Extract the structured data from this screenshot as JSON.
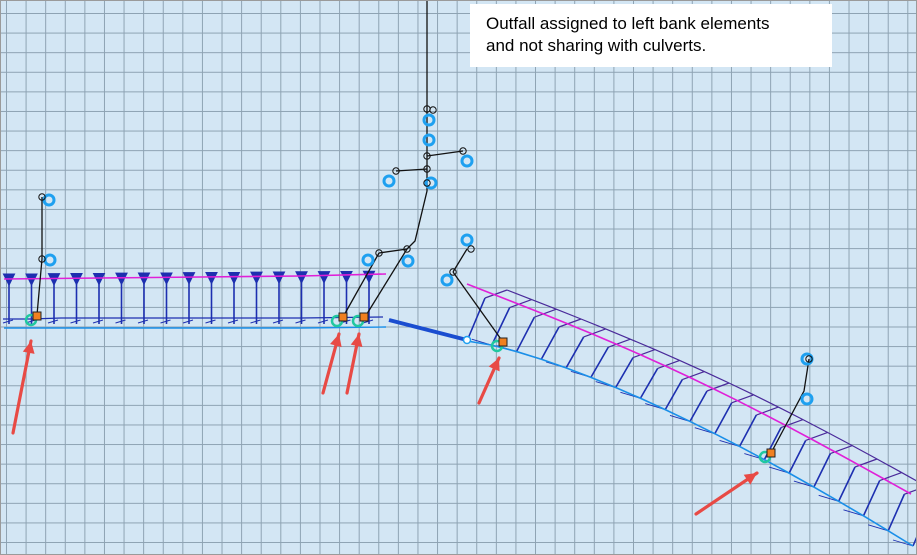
{
  "annotation": {
    "text": "Outfall assigned to left bank elements\nand not sharing with culverts."
  },
  "colors": {
    "grid_background": "#d3e6f4",
    "grid_line": "#8da2b2",
    "bank_line_top": "#e020d8",
    "bank_line_bottom": "#1a8fe8",
    "cross_section": "#1d2fb0",
    "cross_section_dark": "#4a2a9a",
    "inlet_ring": "#1ea0f0",
    "node_outline": "#111111",
    "outfall_node": "#f08020",
    "outfall_ring": "#20c8a0",
    "arrow": "#e84a45",
    "pipe": "#111111",
    "channel_link": "#1a4dd0"
  },
  "icons": {
    "outfall": "outfall-node-icon",
    "inlet": "inlet-ring-icon",
    "junction": "junction-node-icon",
    "pointer": "red-arrow-icon"
  }
}
